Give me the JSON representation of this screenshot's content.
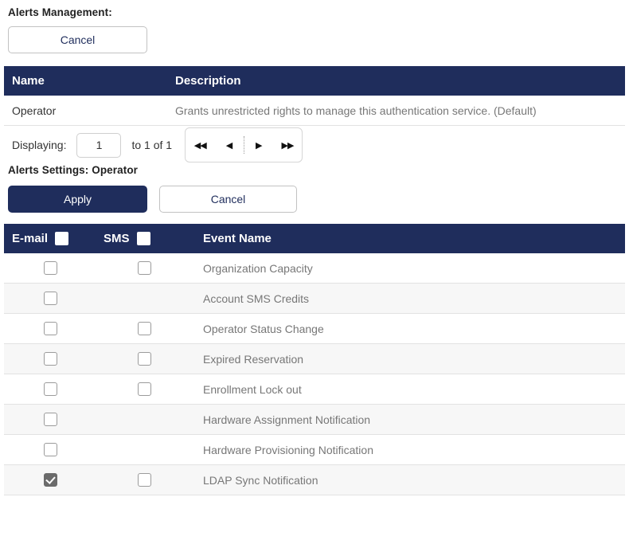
{
  "management": {
    "title": "Alerts Management:",
    "cancel_label": "Cancel",
    "table": {
      "columns": [
        "Name",
        "Description"
      ],
      "rows": [
        {
          "name": "Operator",
          "description": "Grants unrestricted rights to manage this authentication service. (Default)"
        }
      ]
    },
    "pager": {
      "label": "Displaying:",
      "page_value": "1",
      "total_text": "to 1 of 1",
      "buttons": {
        "first": "◀◀",
        "prev": "◀",
        "next": "▶",
        "last": "▶▶"
      }
    }
  },
  "settings": {
    "title": "Alerts Settings: Operator",
    "apply_label": "Apply",
    "cancel_label": "Cancel",
    "table": {
      "columns": {
        "email": "E-mail",
        "sms": "SMS",
        "event": "Event Name"
      },
      "header_checkboxes": {
        "email": false,
        "sms": false
      },
      "rows": [
        {
          "event": "Organization Capacity",
          "email": false,
          "sms": false,
          "has_email": true,
          "has_sms": true
        },
        {
          "event": "Account SMS Credits",
          "email": false,
          "sms": false,
          "has_email": true,
          "has_sms": false
        },
        {
          "event": "Operator Status Change",
          "email": false,
          "sms": false,
          "has_email": true,
          "has_sms": true
        },
        {
          "event": "Expired Reservation",
          "email": false,
          "sms": false,
          "has_email": true,
          "has_sms": true
        },
        {
          "event": "Enrollment Lock out",
          "email": false,
          "sms": false,
          "has_email": true,
          "has_sms": true
        },
        {
          "event": "Hardware Assignment Notification",
          "email": false,
          "sms": false,
          "has_email": true,
          "has_sms": false
        },
        {
          "event": "Hardware Provisioning Notification",
          "email": false,
          "sms": false,
          "has_email": true,
          "has_sms": false
        },
        {
          "event": "LDAP Sync Notification",
          "email": true,
          "sms": false,
          "has_email": true,
          "has_sms": true
        }
      ]
    }
  },
  "colors": {
    "header_navy": "#1f2d5c",
    "row_alt": "#f7f7f7",
    "text_muted": "#777777",
    "checked_box": "#6b6b6b"
  }
}
